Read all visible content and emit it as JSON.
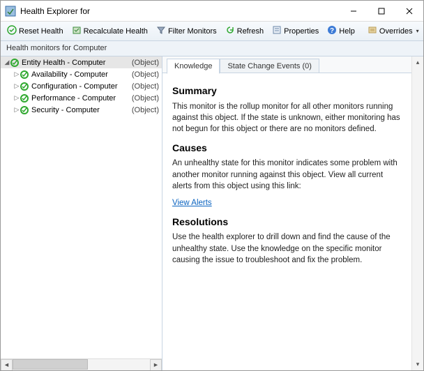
{
  "window": {
    "title": "Health Explorer for"
  },
  "toolbar": {
    "reset": "Reset Health",
    "recalc": "Recalculate Health",
    "filter": "Filter Monitors",
    "refresh": "Refresh",
    "properties": "Properties",
    "help": "Help",
    "overrides": "Overrides"
  },
  "subheader": "Health monitors for  Computer",
  "tree": {
    "object_label": "(Object)",
    "items": [
      {
        "name": "Entity Health",
        "target": "Computer",
        "level": 0,
        "selected": true,
        "expanded": true
      },
      {
        "name": "Availability",
        "target": "Computer",
        "level": 1,
        "selected": false,
        "expanded": false
      },
      {
        "name": "Configuration",
        "target": "Computer",
        "level": 1,
        "selected": false,
        "expanded": false
      },
      {
        "name": "Performance",
        "target": "Computer",
        "level": 1,
        "selected": false,
        "expanded": false
      },
      {
        "name": "Security",
        "target": "Computer",
        "level": 1,
        "selected": false,
        "expanded": false
      }
    ]
  },
  "tabs": {
    "knowledge": "Knowledge",
    "state_change": "State Change Events (0)"
  },
  "knowledge": {
    "summary_h": "Summary",
    "summary_p": "This monitor is the rollup monitor for all other monitors running against this object. If the state is unknown, either monitoring has not begun for this object or there are no monitors defined.",
    "causes_h": "Causes",
    "causes_p": "An unhealthy state for this monitor indicates some problem with another monitor running against this object. View all current alerts from this object using this link:",
    "view_alerts": "View Alerts",
    "resolutions_h": "Resolutions",
    "resolutions_p": "Use the health explorer to drill down and find the cause of the unhealthy state. Use the knowledge on the specific monitor causing the issue to troubleshoot and fix the problem."
  }
}
